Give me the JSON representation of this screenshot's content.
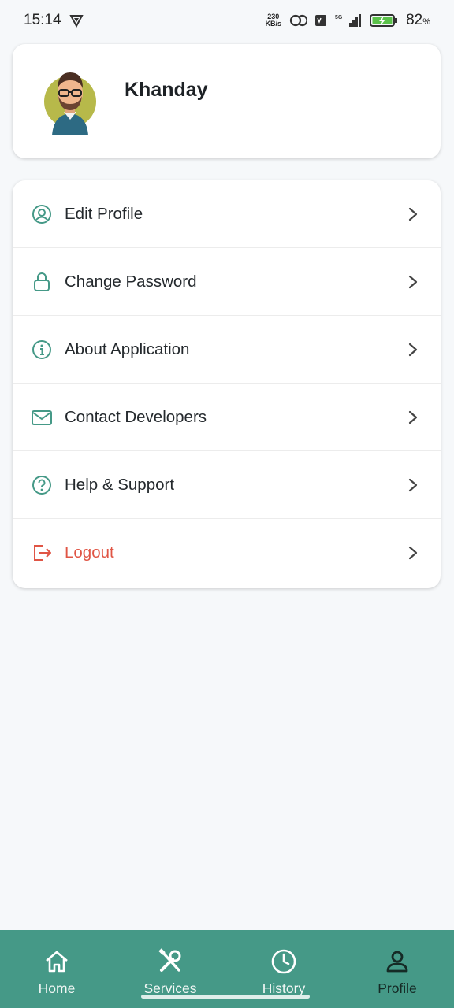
{
  "status_bar": {
    "time": "15:14",
    "net_speed_value": "230",
    "net_speed_unit": "KB/s",
    "network": "5G+",
    "battery_percent": "82",
    "battery_unit": "%"
  },
  "profile": {
    "name": "Khanday"
  },
  "menu": {
    "items": [
      {
        "label": "Edit Profile",
        "icon": "user-circle-icon"
      },
      {
        "label": "Change Password",
        "icon": "lock-icon"
      },
      {
        "label": "About Application",
        "icon": "info-icon"
      },
      {
        "label": "Contact Developers",
        "icon": "mail-icon"
      },
      {
        "label": "Help & Support",
        "icon": "help-icon"
      },
      {
        "label": "Logout",
        "icon": "logout-icon"
      }
    ]
  },
  "bottom_nav": {
    "items": [
      {
        "label": "Home",
        "icon": "home-icon"
      },
      {
        "label": "Services",
        "icon": "tools-icon"
      },
      {
        "label": "History",
        "icon": "clock-icon"
      },
      {
        "label": "Profile",
        "icon": "person-icon",
        "active": true
      }
    ]
  },
  "colors": {
    "accent": "#459987",
    "danger": "#e05545",
    "background": "#f6f8fa"
  }
}
